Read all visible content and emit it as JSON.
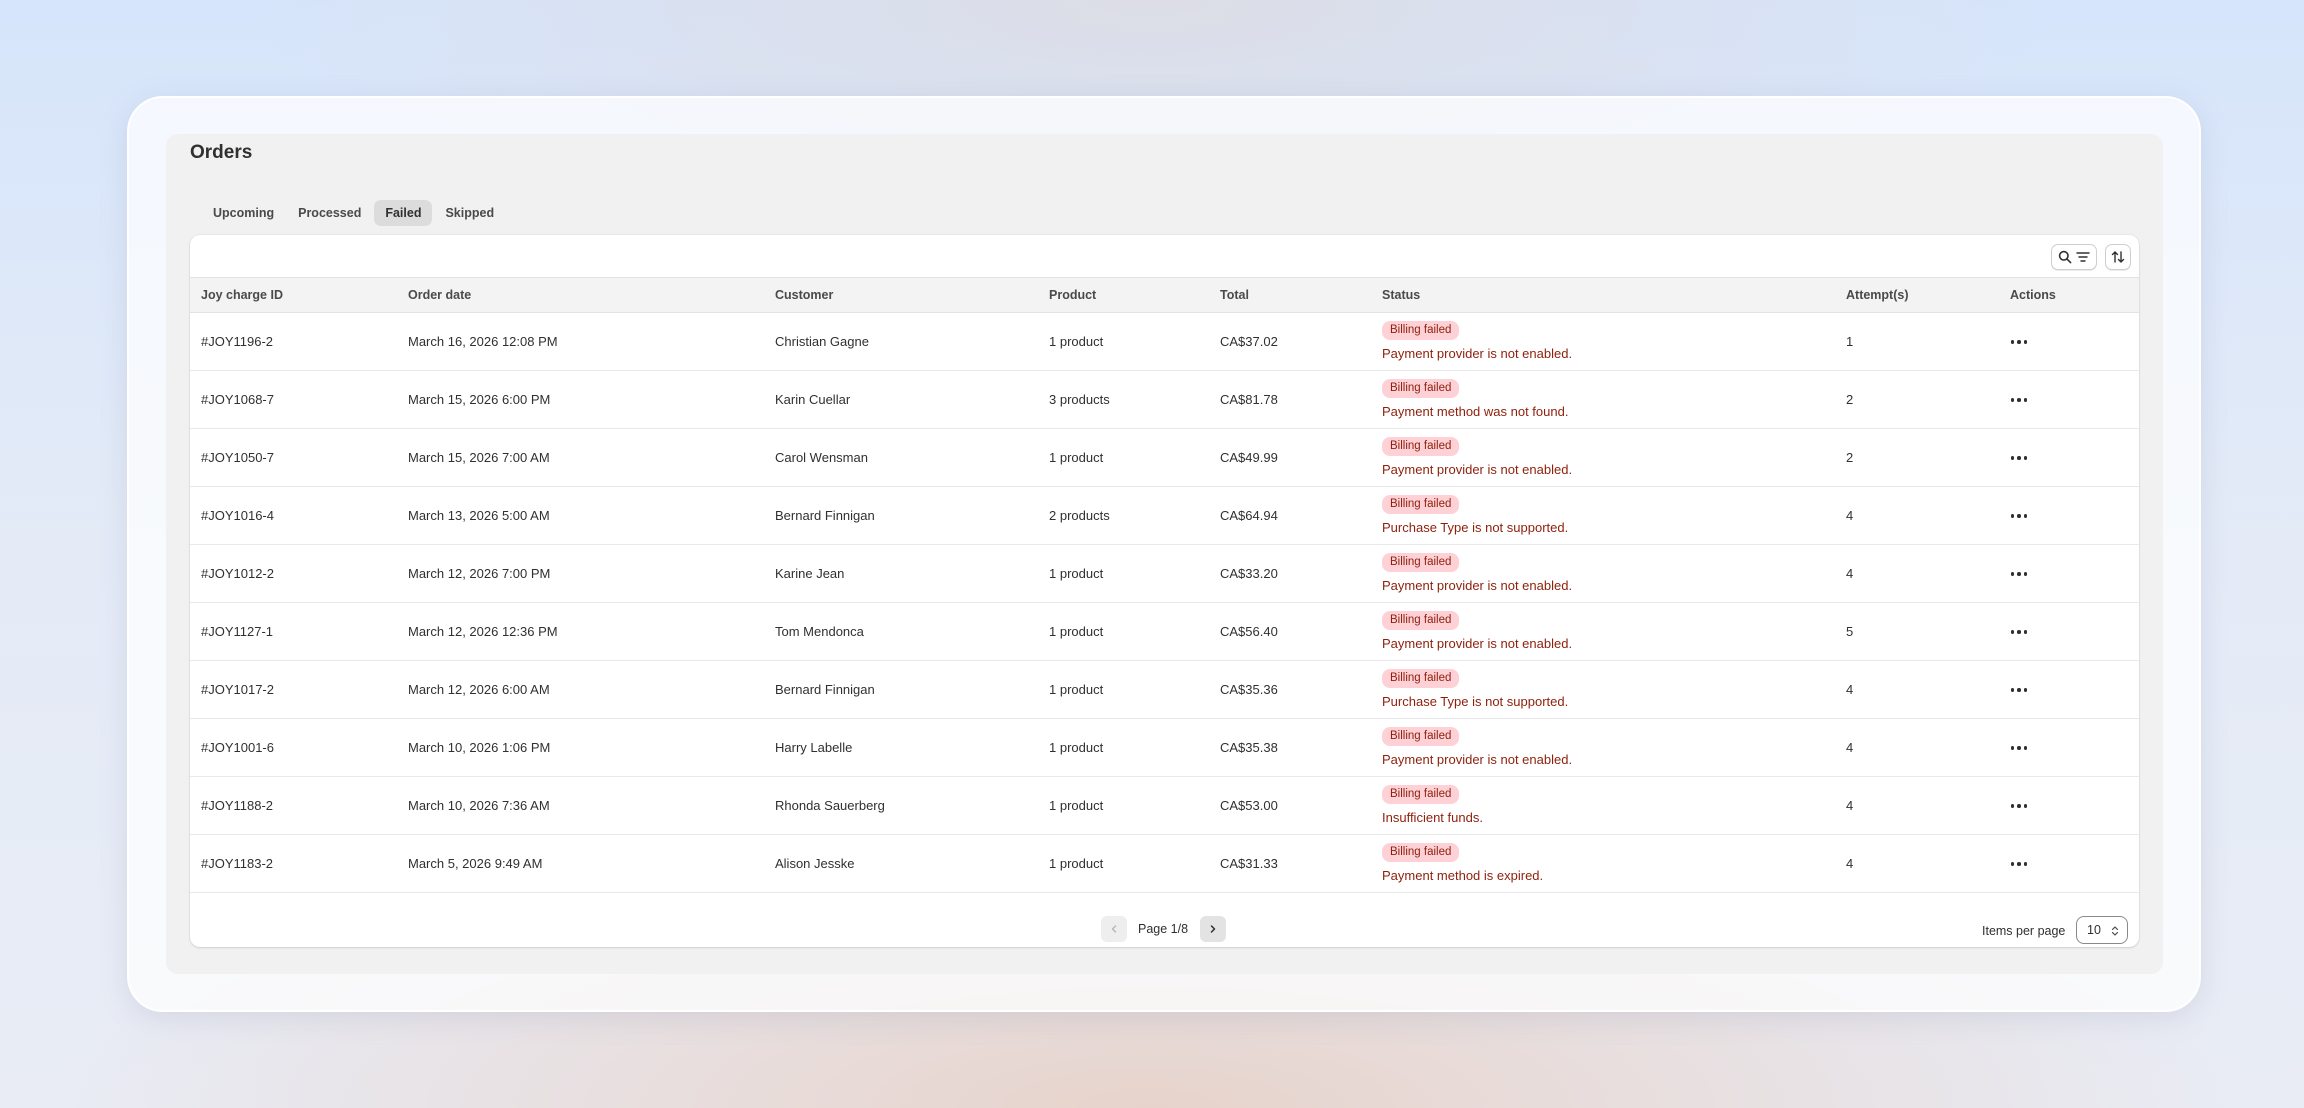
{
  "page": {
    "title": "Orders"
  },
  "tabs": [
    {
      "label": "Upcoming",
      "active": false
    },
    {
      "label": "Processed",
      "active": false
    },
    {
      "label": "Failed",
      "active": true
    },
    {
      "label": "Skipped",
      "active": false
    }
  ],
  "toolbar": {
    "search_filter_icon": "search-filter-icon",
    "sort_icon": "sort-icon"
  },
  "table": {
    "headers": {
      "charge_id": "Joy charge ID",
      "order_date": "Order date",
      "customer": "Customer",
      "product": "Product",
      "total": "Total",
      "status": "Status",
      "attempts": "Attempt(s)",
      "actions": "Actions"
    },
    "rows": [
      {
        "charge_id": "#JOY1196-2",
        "order_date": "March 16, 2026 12:08 PM",
        "customer": "Christian Gagne",
        "product": "1 product",
        "total": "CA$37.02",
        "status": "Billing failed",
        "message": "Payment provider is not enabled.",
        "attempts": "1"
      },
      {
        "charge_id": "#JOY1068-7",
        "order_date": "March 15, 2026 6:00 PM",
        "customer": "Karin Cuellar",
        "product": "3 products",
        "total": "CA$81.78",
        "status": "Billing failed",
        "message": "Payment method was not found.",
        "attempts": "2"
      },
      {
        "charge_id": "#JOY1050-7",
        "order_date": "March 15, 2026 7:00 AM",
        "customer": "Carol Wensman",
        "product": "1 product",
        "total": "CA$49.99",
        "status": "Billing failed",
        "message": "Payment provider is not enabled.",
        "attempts": "2"
      },
      {
        "charge_id": "#JOY1016-4",
        "order_date": "March 13, 2026 5:00 AM",
        "customer": "Bernard Finnigan",
        "product": "2 products",
        "total": "CA$64.94",
        "status": "Billing failed",
        "message": "Purchase Type is not supported.",
        "attempts": "4"
      },
      {
        "charge_id": "#JOY1012-2",
        "order_date": "March 12, 2026 7:00 PM",
        "customer": "Karine Jean",
        "product": "1 product",
        "total": "CA$33.20",
        "status": "Billing failed",
        "message": "Payment provider is not enabled.",
        "attempts": "4"
      },
      {
        "charge_id": "#JOY1127-1",
        "order_date": "March 12, 2026 12:36 PM",
        "customer": "Tom Mendonca",
        "product": "1 product",
        "total": "CA$56.40",
        "status": "Billing failed",
        "message": "Payment provider is not enabled.",
        "attempts": "5"
      },
      {
        "charge_id": "#JOY1017-2",
        "order_date": "March 12, 2026 6:00 AM",
        "customer": "Bernard Finnigan",
        "product": "1 product",
        "total": "CA$35.36",
        "status": "Billing failed",
        "message": "Purchase Type is not supported.",
        "attempts": "4"
      },
      {
        "charge_id": "#JOY1001-6",
        "order_date": "March 10, 2026 1:06 PM",
        "customer": "Harry Labelle",
        "product": "1 product",
        "total": "CA$35.38",
        "status": "Billing failed",
        "message": "Payment provider is not enabled.",
        "attempts": "4"
      },
      {
        "charge_id": "#JOY1188-2",
        "order_date": "March 10, 2026 7:36 AM",
        "customer": "Rhonda Sauerberg",
        "product": "1 product",
        "total": "CA$53.00",
        "status": "Billing failed",
        "message": "Insufficient funds.",
        "attempts": "4"
      },
      {
        "charge_id": "#JOY1183-2",
        "order_date": "March 5, 2026 9:49 AM",
        "customer": "Alison Jesske",
        "product": "1 product",
        "total": "CA$31.33",
        "status": "Billing failed",
        "message": "Payment method is expired.",
        "attempts": "4"
      }
    ]
  },
  "pagination": {
    "label": "Page 1/8",
    "items_per_page_label": "Items per page",
    "items_per_page_value": "10"
  },
  "colors": {
    "status_badge_bg": "#fed1d7",
    "status_text": "#8e1f0b",
    "active_tab_bg": "#dcdcdc"
  }
}
